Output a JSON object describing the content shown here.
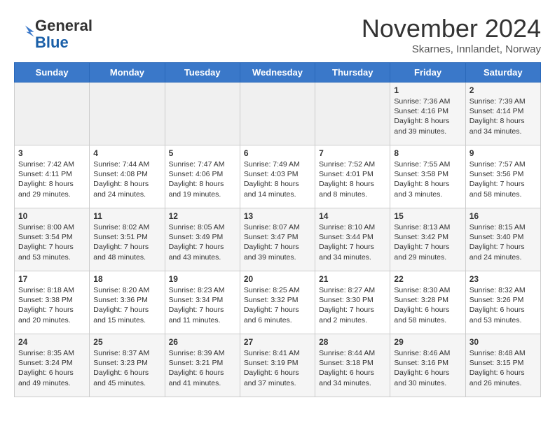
{
  "header": {
    "logo_line1": "General",
    "logo_line2": "Blue",
    "month": "November 2024",
    "location": "Skarnes, Innlandet, Norway"
  },
  "weekdays": [
    "Sunday",
    "Monday",
    "Tuesday",
    "Wednesday",
    "Thursday",
    "Friday",
    "Saturday"
  ],
  "weeks": [
    [
      {
        "day": "",
        "info": ""
      },
      {
        "day": "",
        "info": ""
      },
      {
        "day": "",
        "info": ""
      },
      {
        "day": "",
        "info": ""
      },
      {
        "day": "",
        "info": ""
      },
      {
        "day": "1",
        "info": "Sunrise: 7:36 AM\nSunset: 4:16 PM\nDaylight: 8 hours\nand 39 minutes."
      },
      {
        "day": "2",
        "info": "Sunrise: 7:39 AM\nSunset: 4:14 PM\nDaylight: 8 hours\nand 34 minutes."
      }
    ],
    [
      {
        "day": "3",
        "info": "Sunrise: 7:42 AM\nSunset: 4:11 PM\nDaylight: 8 hours\nand 29 minutes."
      },
      {
        "day": "4",
        "info": "Sunrise: 7:44 AM\nSunset: 4:08 PM\nDaylight: 8 hours\nand 24 minutes."
      },
      {
        "day": "5",
        "info": "Sunrise: 7:47 AM\nSunset: 4:06 PM\nDaylight: 8 hours\nand 19 minutes."
      },
      {
        "day": "6",
        "info": "Sunrise: 7:49 AM\nSunset: 4:03 PM\nDaylight: 8 hours\nand 14 minutes."
      },
      {
        "day": "7",
        "info": "Sunrise: 7:52 AM\nSunset: 4:01 PM\nDaylight: 8 hours\nand 8 minutes."
      },
      {
        "day": "8",
        "info": "Sunrise: 7:55 AM\nSunset: 3:58 PM\nDaylight: 8 hours\nand 3 minutes."
      },
      {
        "day": "9",
        "info": "Sunrise: 7:57 AM\nSunset: 3:56 PM\nDaylight: 7 hours\nand 58 minutes."
      }
    ],
    [
      {
        "day": "10",
        "info": "Sunrise: 8:00 AM\nSunset: 3:54 PM\nDaylight: 7 hours\nand 53 minutes."
      },
      {
        "day": "11",
        "info": "Sunrise: 8:02 AM\nSunset: 3:51 PM\nDaylight: 7 hours\nand 48 minutes."
      },
      {
        "day": "12",
        "info": "Sunrise: 8:05 AM\nSunset: 3:49 PM\nDaylight: 7 hours\nand 43 minutes."
      },
      {
        "day": "13",
        "info": "Sunrise: 8:07 AM\nSunset: 3:47 PM\nDaylight: 7 hours\nand 39 minutes."
      },
      {
        "day": "14",
        "info": "Sunrise: 8:10 AM\nSunset: 3:44 PM\nDaylight: 7 hours\nand 34 minutes."
      },
      {
        "day": "15",
        "info": "Sunrise: 8:13 AM\nSunset: 3:42 PM\nDaylight: 7 hours\nand 29 minutes."
      },
      {
        "day": "16",
        "info": "Sunrise: 8:15 AM\nSunset: 3:40 PM\nDaylight: 7 hours\nand 24 minutes."
      }
    ],
    [
      {
        "day": "17",
        "info": "Sunrise: 8:18 AM\nSunset: 3:38 PM\nDaylight: 7 hours\nand 20 minutes."
      },
      {
        "day": "18",
        "info": "Sunrise: 8:20 AM\nSunset: 3:36 PM\nDaylight: 7 hours\nand 15 minutes."
      },
      {
        "day": "19",
        "info": "Sunrise: 8:23 AM\nSunset: 3:34 PM\nDaylight: 7 hours\nand 11 minutes."
      },
      {
        "day": "20",
        "info": "Sunrise: 8:25 AM\nSunset: 3:32 PM\nDaylight: 7 hours\nand 6 minutes."
      },
      {
        "day": "21",
        "info": "Sunrise: 8:27 AM\nSunset: 3:30 PM\nDaylight: 7 hours\nand 2 minutes."
      },
      {
        "day": "22",
        "info": "Sunrise: 8:30 AM\nSunset: 3:28 PM\nDaylight: 6 hours\nand 58 minutes."
      },
      {
        "day": "23",
        "info": "Sunrise: 8:32 AM\nSunset: 3:26 PM\nDaylight: 6 hours\nand 53 minutes."
      }
    ],
    [
      {
        "day": "24",
        "info": "Sunrise: 8:35 AM\nSunset: 3:24 PM\nDaylight: 6 hours\nand 49 minutes."
      },
      {
        "day": "25",
        "info": "Sunrise: 8:37 AM\nSunset: 3:23 PM\nDaylight: 6 hours\nand 45 minutes."
      },
      {
        "day": "26",
        "info": "Sunrise: 8:39 AM\nSunset: 3:21 PM\nDaylight: 6 hours\nand 41 minutes."
      },
      {
        "day": "27",
        "info": "Sunrise: 8:41 AM\nSunset: 3:19 PM\nDaylight: 6 hours\nand 37 minutes."
      },
      {
        "day": "28",
        "info": "Sunrise: 8:44 AM\nSunset: 3:18 PM\nDaylight: 6 hours\nand 34 minutes."
      },
      {
        "day": "29",
        "info": "Sunrise: 8:46 AM\nSunset: 3:16 PM\nDaylight: 6 hours\nand 30 minutes."
      },
      {
        "day": "30",
        "info": "Sunrise: 8:48 AM\nSunset: 3:15 PM\nDaylight: 6 hours\nand 26 minutes."
      }
    ]
  ]
}
